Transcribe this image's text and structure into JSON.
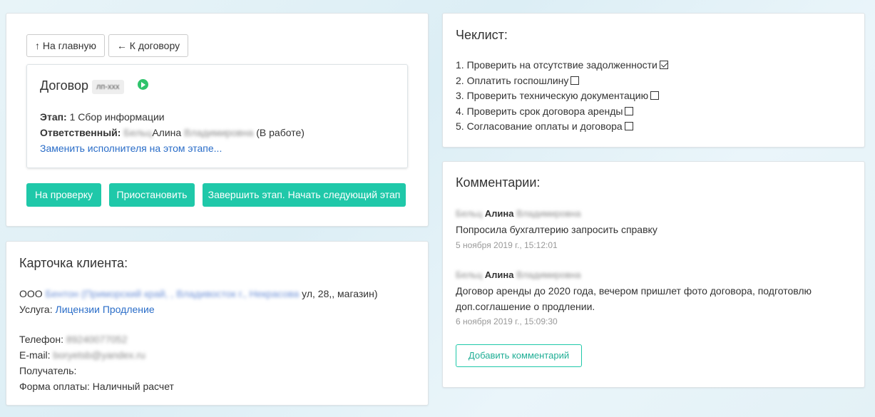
{
  "contract_panel": {
    "nav": {
      "home_label": "↑ На главную",
      "contract_label": "← К договору"
    },
    "card": {
      "title": "Договор",
      "number": "лп-ххх",
      "stage_label": "Этап:",
      "stage_value": "1 Сбор информации",
      "responsible_label": "Ответственный:",
      "responsible_surname": "Бельц",
      "responsible_name": "Алина",
      "responsible_patronymic": "Владимировна",
      "responsible_status": "(В работе)",
      "change_link": "Заменить исполнителя на этом этапе..."
    },
    "actions": {
      "review": "На проверку",
      "pause": "Приостановить",
      "finish": "Завершить этап. Начать следующий этап"
    }
  },
  "client_panel": {
    "title": "Карточка клиента:",
    "org_prefix": "ООО",
    "org_blurred": "Бентон (Приморский край, , Владивосток г., Некрасова",
    "org_suffix": "ул, 28,, магазин)",
    "service_label": "Услуга:",
    "service_value": "Лицензии Продление",
    "phone_label": "Телефон:",
    "phone_value": "89240077052",
    "email_label": "E-mail:",
    "email_value": "boryetsb@yandex.ru",
    "recipient_label": "Получатель:",
    "payment_label": "Форма оплаты:",
    "payment_value": "Наличный расчет"
  },
  "checklist_panel": {
    "title": "Чеклист:",
    "items": [
      {
        "label": "1. Проверить на отсутствие задолженности",
        "checked": true
      },
      {
        "label": "2. Оплатить госпошлину",
        "checked": false
      },
      {
        "label": "3. Проверить техническую документацию",
        "checked": false
      },
      {
        "label": "4. Проверить срок договора аренды",
        "checked": false
      },
      {
        "label": "5. Согласование оплаты и договора",
        "checked": false
      }
    ]
  },
  "comments_panel": {
    "title": "Комментарии:",
    "comments": [
      {
        "author_surname": "Бельц",
        "author_name": "Алина",
        "author_patronymic": "Владимировна",
        "text": "Попросила бухгалтерию запросить справку",
        "date": "5 ноября 2019 г., 15:12:01"
      },
      {
        "author_surname": "Бельц",
        "author_name": "Алина",
        "author_patronymic": "Владимировна",
        "text": "Договор аренды до 2020 года, вечером пришлет фото договора, подготовлю доп.соглашение о продлении.",
        "date": "6 ноября 2019 г., 15:09:30"
      }
    ],
    "add_button": "Добавить комментарий"
  }
}
